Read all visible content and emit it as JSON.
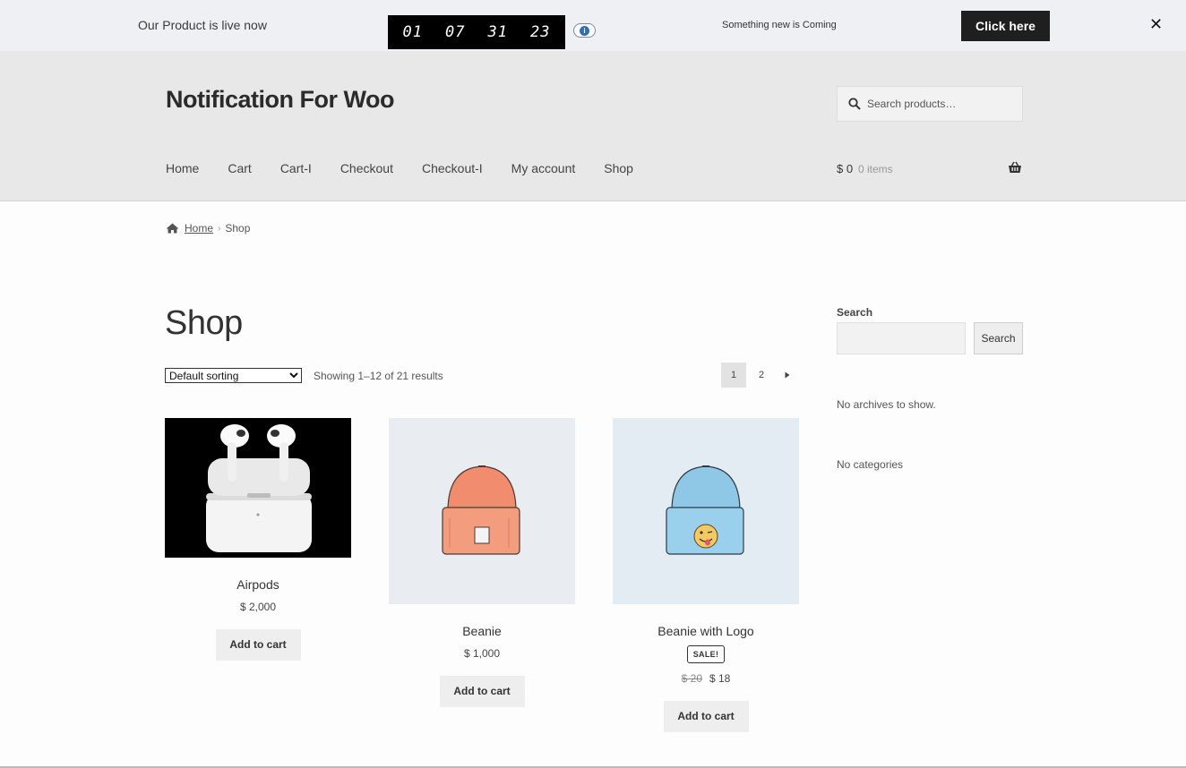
{
  "notification": {
    "text": "Our Product is live now",
    "countdown": [
      "01",
      "07",
      "31",
      "23"
    ],
    "coming_text": "Something new is Coming",
    "button_label": "Click here",
    "close_label": "✕"
  },
  "header": {
    "site_title": "Notification For Woo",
    "search_placeholder": "Search products…",
    "nav": [
      "Home",
      "Cart",
      "Cart-I",
      "Checkout",
      "Checkout-I",
      "My account",
      "Shop"
    ],
    "cart_amount": "$ 0",
    "cart_count": "0 items"
  },
  "breadcrumb": {
    "home": "Home",
    "current": "Shop"
  },
  "shop": {
    "title": "Shop",
    "sorting_selected": "Default sorting",
    "result_count": "Showing 1–12 of 21 results",
    "pages": [
      "1",
      "2"
    ],
    "products": [
      {
        "name": "Airpods",
        "price": "$ 2,000",
        "button": "Add to cart"
      },
      {
        "name": "Beanie",
        "price": "$ 1,000",
        "button": "Add to cart"
      },
      {
        "name": "Beanie with Logo",
        "sale_badge": "SALE!",
        "old_price": "$ 20",
        "price": "$ 18",
        "button": "Add to cart"
      }
    ]
  },
  "sidebar": {
    "search_label": "Search",
    "search_button": "Search",
    "archives_text": "No archives to show.",
    "categories_text": "No categories"
  },
  "colors": {
    "notification_bg": "#eef0f3",
    "header_bg": "#e8e8e8",
    "beanie_orange": "#f28c6e",
    "beanie_blue": "#8fc7e6"
  }
}
